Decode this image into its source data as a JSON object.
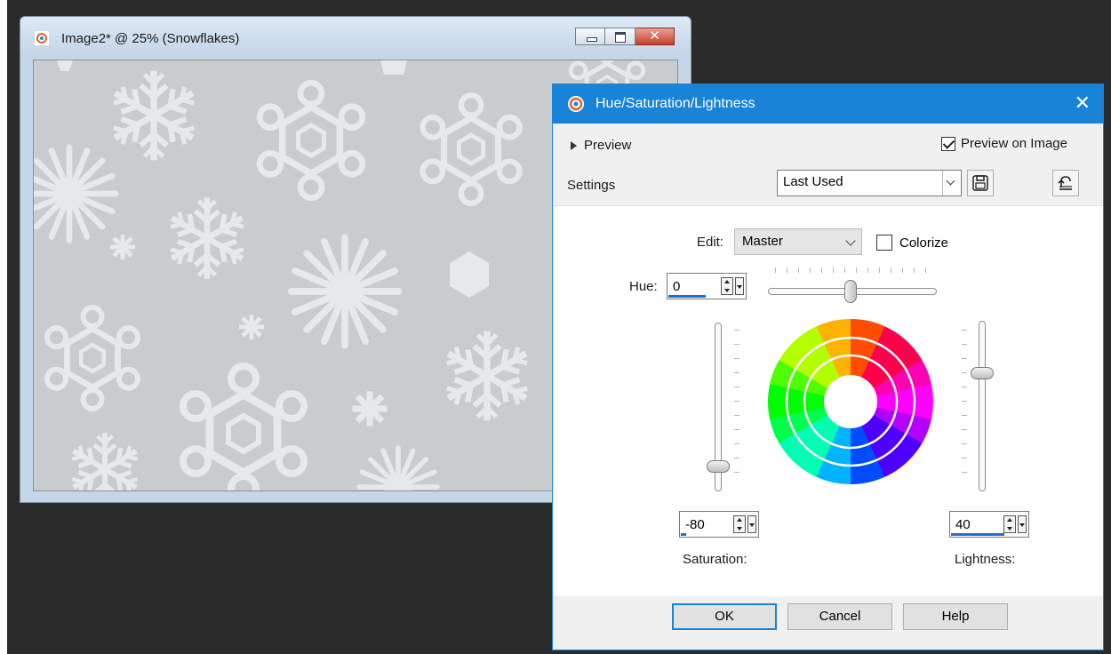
{
  "image_window": {
    "title": "Image2* @  25% (Snowflakes)"
  },
  "dialog": {
    "title": "Hue/Saturation/Lightness",
    "preview_label": "Preview",
    "preview_on_image_label": "Preview on Image",
    "preview_on_image_checked": true,
    "settings_label": "Settings",
    "settings_value": "Last Used",
    "edit_label": "Edit:",
    "edit_value": "Master",
    "colorize_label": "Colorize",
    "colorize_checked": false,
    "hue_label": "Hue:",
    "hue_value": "0",
    "saturation_value": "-80",
    "saturation_label": "Saturation:",
    "lightness_value": "40",
    "lightness_label": "Lightness:",
    "ok_label": "OK",
    "cancel_label": "Cancel",
    "help_label": "Help"
  },
  "colors": {
    "desktop": "#2b2b2b",
    "dialog_accent": "#1883d7",
    "canvas_bg": "#c8ccce",
    "snowflake": "#e6e9ea"
  }
}
